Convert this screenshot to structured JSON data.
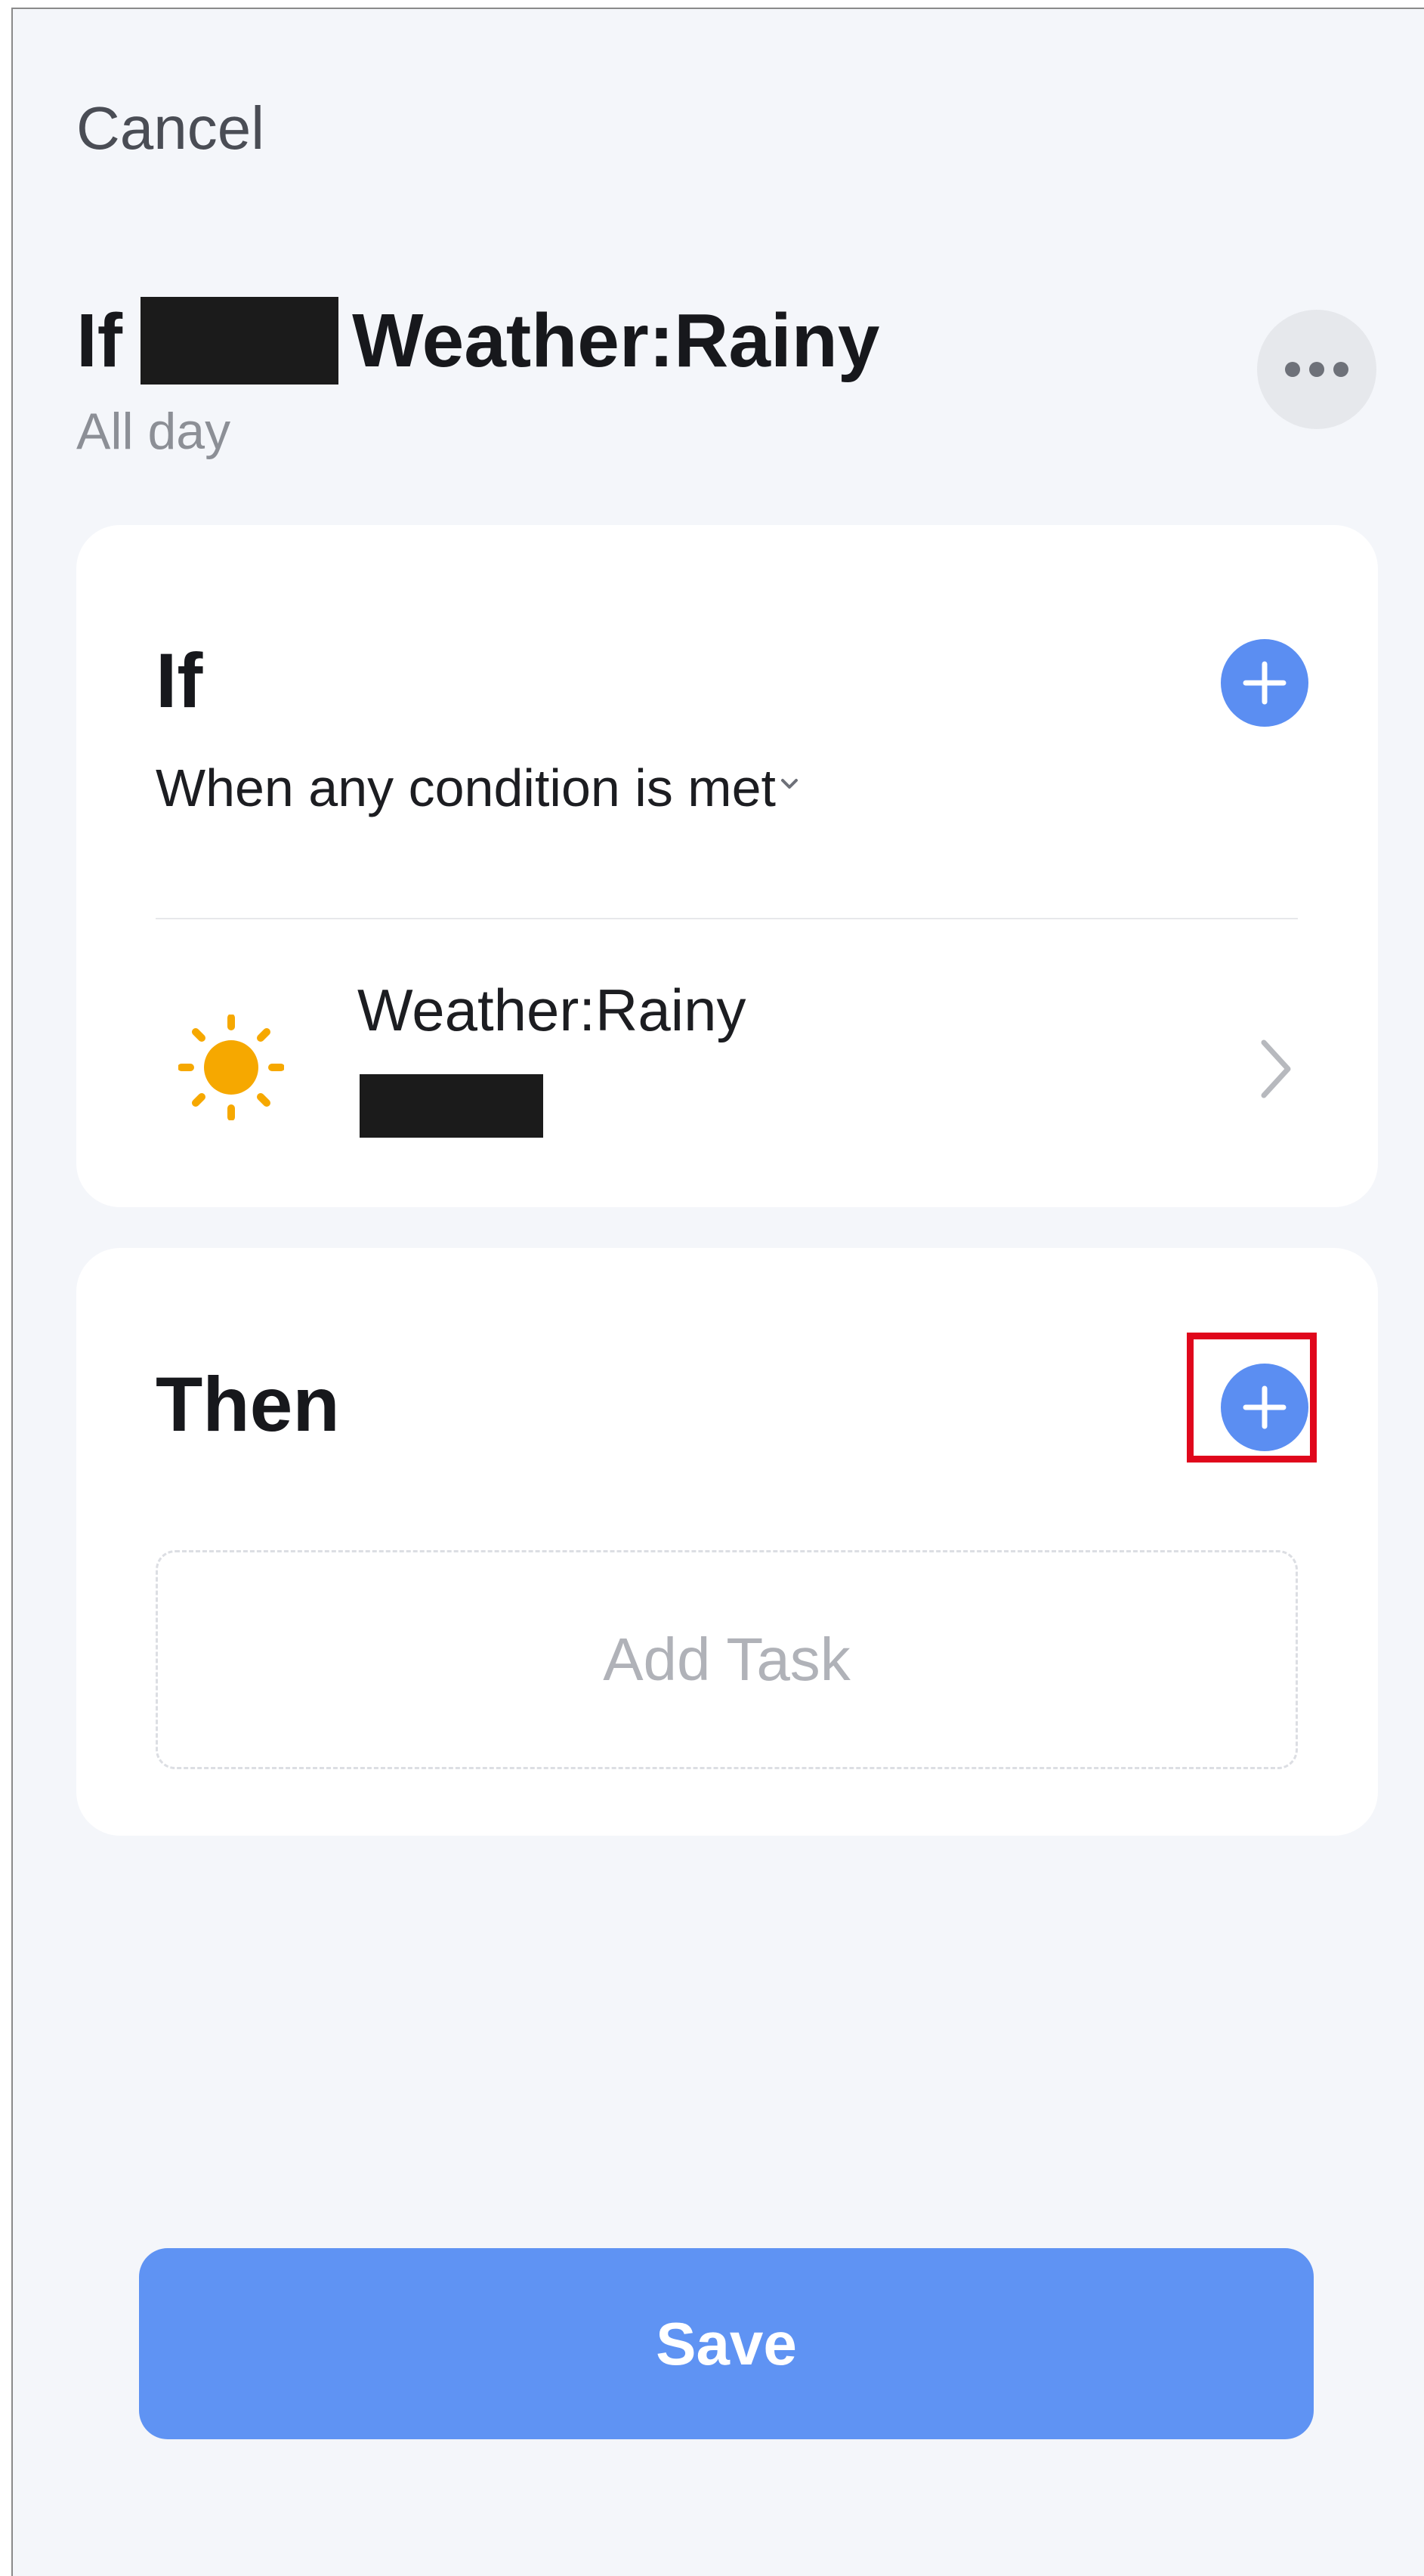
{
  "header": {
    "cancel_label": "Cancel",
    "title_prefix": "If",
    "title_suffix": "Weather:Rainy",
    "subtitle": "All day",
    "more_icon": "more-horizontal-icon"
  },
  "if_section": {
    "title": "If",
    "add_icon": "plus-icon",
    "condition_mode": "When any condition is met",
    "condition_mode_icon": "chevron-down-icon",
    "conditions": [
      {
        "icon": "sun-icon",
        "title": "Weather:Rainy",
        "chevron_icon": "chevron-right-icon"
      }
    ]
  },
  "then_section": {
    "title": "Then",
    "add_icon": "plus-icon",
    "add_task_label": "Add Task"
  },
  "footer": {
    "save_label": "Save"
  },
  "colors": {
    "background": "#f4f6fa",
    "card": "#ffffff",
    "accent": "#5b8ef2",
    "save_button": "#5f93f3",
    "sun": "#f6a800",
    "highlight": "#e0071c"
  }
}
